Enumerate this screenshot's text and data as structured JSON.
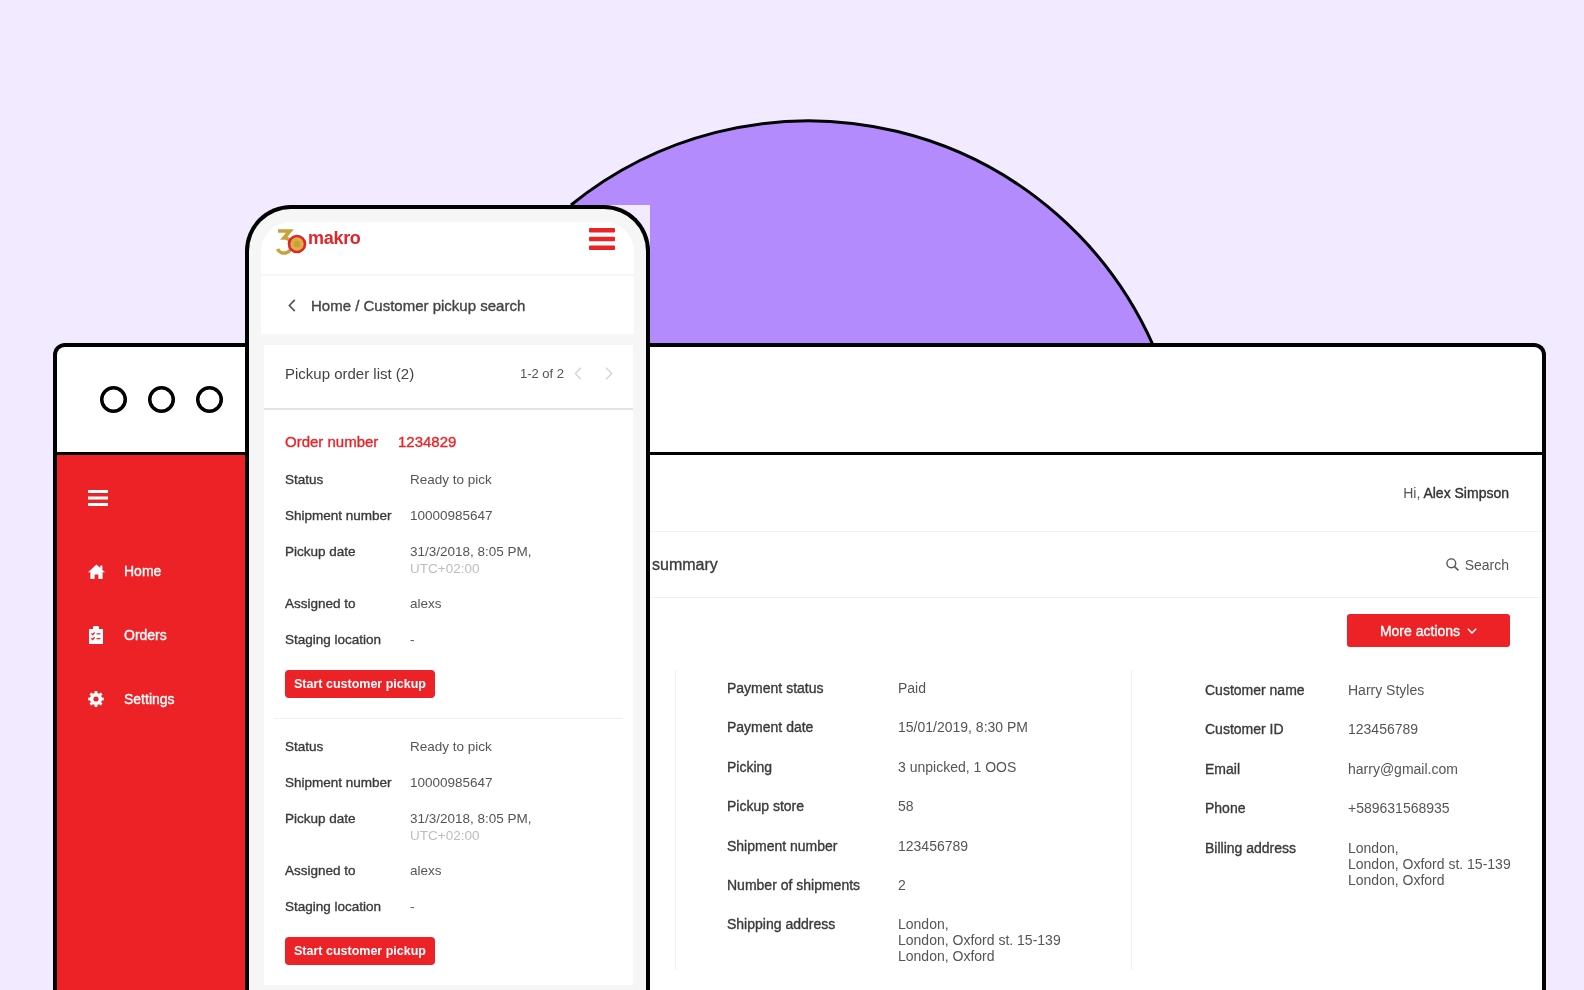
{
  "desktop": {
    "sidebar": {
      "items": [
        {
          "label": "Home",
          "selected": false
        },
        {
          "label": "Orders",
          "selected": false
        },
        {
          "label": "Settings",
          "selected": false
        }
      ]
    },
    "header": {
      "greeting": "Hi, **Alex Simpson**"
    },
    "title": "summary",
    "search": {
      "label": "Search"
    },
    "actions_button": {
      "label": "More actions"
    },
    "details": {
      "columns": [
        {
          "rows": [
            {
              "label": "Payment status",
              "value": "Paid"
            },
            {
              "label": "Payment date",
              "value": "15/01/2019, 8:30 PM"
            },
            {
              "label": "Picking",
              "value": "3 unpicked, 1 OOS"
            },
            {
              "label": "Pickup store",
              "value": "58"
            },
            {
              "label": "Shipment number",
              "value": "123456789"
            },
            {
              "label": "Number of shipments",
              "value": "2"
            },
            {
              "label": "Shipping address",
              "value": "London,\nLondon, Oxford st. 15-139\nLondon, Oxford"
            }
          ]
        },
        {
          "rows": [
            {
              "label": "Customer name",
              "value": "Harry Styles"
            },
            {
              "label": "Customer ID",
              "value": "123456789"
            },
            {
              "label": "Email",
              "value": "harry@gmail.com"
            },
            {
              "label": "Phone",
              "value": "+589631568935"
            },
            {
              "label": "Billing address",
              "value": "London,\nLondon, Oxford st. 15-139\nLondon, Oxford"
            }
          ]
        }
      ]
    }
  },
  "phone": {
    "logo": {
      "text": "makro"
    },
    "breadcrumb": "Home / Customer pickup search",
    "list": {
      "title": "Pickup order list (2)",
      "pager": {
        "text": "1-2 of 2",
        "prev": {
          "disabled": true
        },
        "next": {
          "disabled": true
        }
      },
      "orders": [
        {
          "order_number": {
            "label": "Order number",
            "value": "1234829"
          },
          "fields": [
            {
              "label": "Status",
              "value": "Ready to pick"
            },
            {
              "label": "Shipment number",
              "value": "10000985647"
            },
            {
              "label": "Pickup date",
              "value": "31/3/2018, 8:05 PM,",
              "note": "UTC+02:00"
            },
            {
              "label": "Assigned to",
              "value": "alexs"
            },
            {
              "label": "Staging location",
              "value": "-"
            }
          ],
          "button": "Start customer pickup"
        },
        {
          "fields": [
            {
              "label": "Status",
              "value": "Ready to pick"
            },
            {
              "label": "Shipment number",
              "value": "10000985647"
            },
            {
              "label": "Pickup date",
              "value": "31/3/2018, 8:05 PM,",
              "note": "UTC+02:00"
            },
            {
              "label": "Assigned to",
              "value": "alexs"
            },
            {
              "label": "Staging location",
              "value": "-"
            }
          ],
          "button": "Start customer pickup"
        }
      ]
    }
  }
}
